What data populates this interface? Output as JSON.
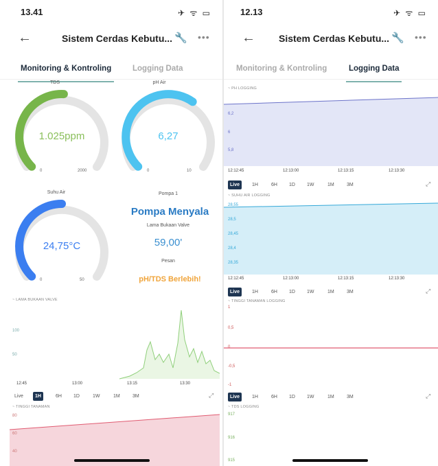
{
  "left": {
    "status_time": "13.41",
    "status_icons": "✈ ᯤ ▭",
    "title": "Sistem Cerdas Kebutu...",
    "tabs": [
      "Monitoring & Kontroling",
      "Logging Data"
    ],
    "gauges": [
      {
        "label": "TDS",
        "value": "1.025ppm",
        "min": "0",
        "max": "2000",
        "fraction": 0.51,
        "color": "#77b54a",
        "value_color": "#8abf5b"
      },
      {
        "label": "pH Air",
        "value": "6,27",
        "min": "0",
        "max": "10",
        "fraction": 0.63,
        "color": "#4dc3f0",
        "value_color": "#4dc3f0"
      },
      {
        "label": "Suhu Air",
        "value": "24,75°C",
        "min": "0",
        "max": "50",
        "fraction": 0.5,
        "color": "#3b7ef0",
        "value_color": "#3b7ef0"
      }
    ],
    "pump": {
      "label": "Pompa 1",
      "state": "Pompa Menyala",
      "valve_label": "Lama Bukaan Valve",
      "valve_value": "59,00'",
      "message_label": "Pesan",
      "message": "pH/TDS Berlebih!"
    },
    "valve_chart": {
      "title": "~ LAMA BUKAAN VALVE",
      "y_labels": [
        "100",
        "50"
      ],
      "x_labels": [
        "12:45",
        "13:00",
        "13:15",
        "13:30"
      ]
    },
    "range_buttons": [
      "Live",
      "1H",
      "6H",
      "1D",
      "1W",
      "1M",
      "3M"
    ],
    "range_active": "1H",
    "height_chart": {
      "title": "~ TINGGI TANAMAN",
      "y_labels": [
        "80",
        "60",
        "40"
      ]
    }
  },
  "right": {
    "status_time": "12.13",
    "status_icons": "✈ ᯤ ▭",
    "title": "Sistem Cerdas Kebutu...",
    "tabs": [
      "Monitoring & Kontroling",
      "Logging Data"
    ],
    "range_buttons": [
      "Live",
      "1H",
      "6H",
      "1D",
      "1W",
      "1M",
      "3M"
    ],
    "range_active": "Live",
    "ph_chart": {
      "title": "~ PH LOGGING",
      "y_labels": [
        "6,2",
        "6",
        "5,8"
      ],
      "x_labels": [
        "12:12:45",
        "12:13:00",
        "12:13:15",
        "12:13:30"
      ]
    },
    "suhu_chart": {
      "title": "~ SUHU AIR LOGGING",
      "y_labels": [
        "28,55",
        "28,5",
        "28,45",
        "28,4",
        "28,35"
      ],
      "x_labels": [
        "12:12:45",
        "12:13:00",
        "12:13:15",
        "12:13:30"
      ]
    },
    "tinggi_chart": {
      "title": "~ TINGGI TANAMAN LOGGING",
      "y_labels": [
        "1",
        "0,5",
        "0",
        "-0,5",
        "-1"
      ]
    },
    "tds_chart": {
      "title": "~ TDS LOGGING",
      "y_labels": [
        "917",
        "916",
        "915"
      ]
    }
  },
  "colors": {
    "accent_dark": "#1e3552",
    "tab_underline": "#7fb2ad",
    "ph_fill": "#e3e6f7",
    "suhu_fill": "#d5eef8",
    "tinggi_line": "#e05a70",
    "height_fill": "#f3c5ce",
    "valve_line": "#8fcf7a"
  }
}
